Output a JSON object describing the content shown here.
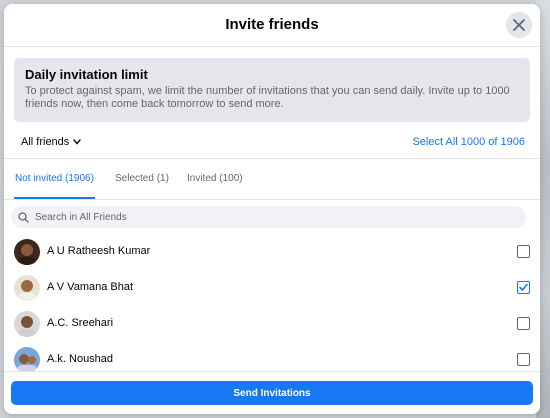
{
  "dialog": {
    "title": "Invite friends"
  },
  "info": {
    "title": "Daily invitation limit",
    "text": "To protect against spam, we limit the number of invitations that you can send daily. Invite up to 1000 friends now, then come back tomorrow to send more."
  },
  "filter": {
    "dropdown_label": "All friends",
    "select_all_label": "Select All 1000 of 1906"
  },
  "tabs": [
    {
      "label": "Not invited (1906)",
      "active": true
    },
    {
      "label": "Selected (1)",
      "active": false
    },
    {
      "label": "Invited (100)",
      "active": false
    }
  ],
  "search": {
    "placeholder": "Search in All Friends",
    "value": ""
  },
  "friends": [
    {
      "name": "A U Ratheesh Kumar",
      "checked": false
    },
    {
      "name": "A V Vamana Bhat",
      "checked": true
    },
    {
      "name": "A.C. Sreehari",
      "checked": false
    },
    {
      "name": "A.k. Noushad",
      "checked": false
    }
  ],
  "footer": {
    "send_label": "Send Invitations"
  },
  "colors": {
    "accent": "#1877f2",
    "surface": "#e4e6eb"
  }
}
